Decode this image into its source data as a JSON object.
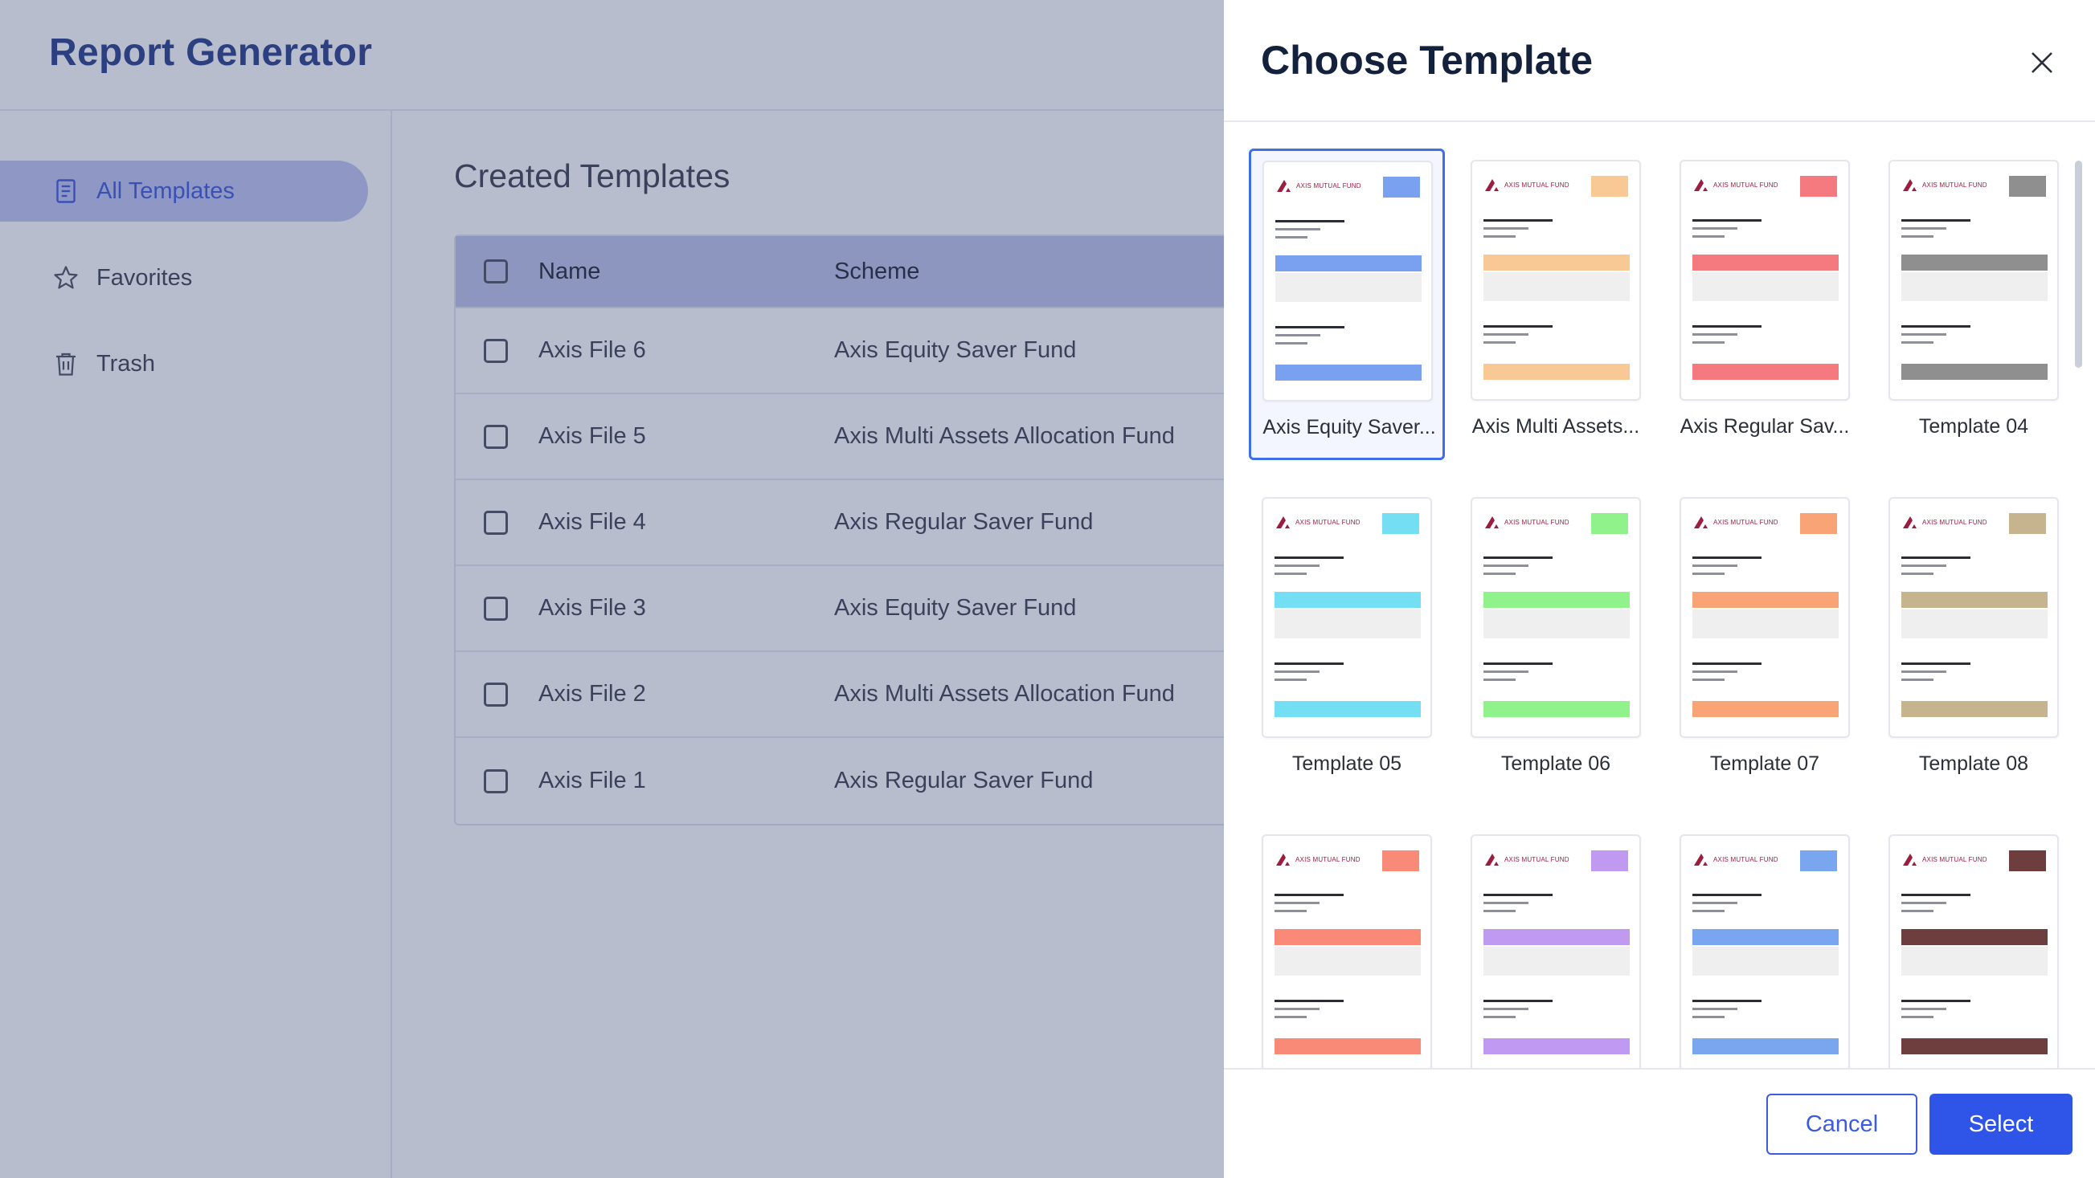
{
  "app": {
    "title": "Report Generator",
    "sidebar": [
      {
        "label": "All Templates",
        "icon": "document-icon",
        "active": true
      },
      {
        "label": "Favorites",
        "icon": "star-icon",
        "active": false
      },
      {
        "label": "Trash",
        "icon": "trash-icon",
        "active": false
      }
    ],
    "section_title": "Created Templates",
    "table": {
      "headers": {
        "name": "Name",
        "scheme": "Scheme"
      },
      "rows": [
        {
          "name": "Axis File 6",
          "scheme": "Axis Equity Saver Fund"
        },
        {
          "name": "Axis File 5",
          "scheme": "Axis Multi Assets Allocation Fund"
        },
        {
          "name": "Axis File 4",
          "scheme": "Axis Regular Saver Fund"
        },
        {
          "name": "Axis File 3",
          "scheme": "Axis Equity Saver Fund"
        },
        {
          "name": "Axis File 2",
          "scheme": "Axis Multi Assets Allocation Fund"
        },
        {
          "name": "Axis File 1",
          "scheme": "Axis Regular Saver Fund"
        }
      ]
    }
  },
  "drawer": {
    "title": "Choose Template",
    "close_icon": "close-icon",
    "brand_text": "AXIS MUTUAL FUND",
    "templates": [
      {
        "label": "Axis Equity Saver...",
        "color": "#7aa0f0",
        "selected": true
      },
      {
        "label": "Axis Multi Assets...",
        "color": "#f8c995",
        "selected": false
      },
      {
        "label": "Axis Regular Sav...",
        "color": "#f47a80",
        "selected": false
      },
      {
        "label": "Template 04",
        "color": "#8f8f8f",
        "selected": false
      },
      {
        "label": "Template 05",
        "color": "#74def2",
        "selected": false
      },
      {
        "label": "Template 06",
        "color": "#8ff28a",
        "selected": false
      },
      {
        "label": "Template 07",
        "color": "#f8a477",
        "selected": false
      },
      {
        "label": "Template 08",
        "color": "#c5b48e",
        "selected": false
      },
      {
        "label": "",
        "color": "#f98a78",
        "selected": false
      },
      {
        "label": "",
        "color": "#c09af0",
        "selected": false
      },
      {
        "label": "",
        "color": "#7aa6f0",
        "selected": false
      },
      {
        "label": "",
        "color": "#6e3d3d",
        "selected": false
      }
    ],
    "cancel_label": "Cancel",
    "select_label": "Select"
  }
}
